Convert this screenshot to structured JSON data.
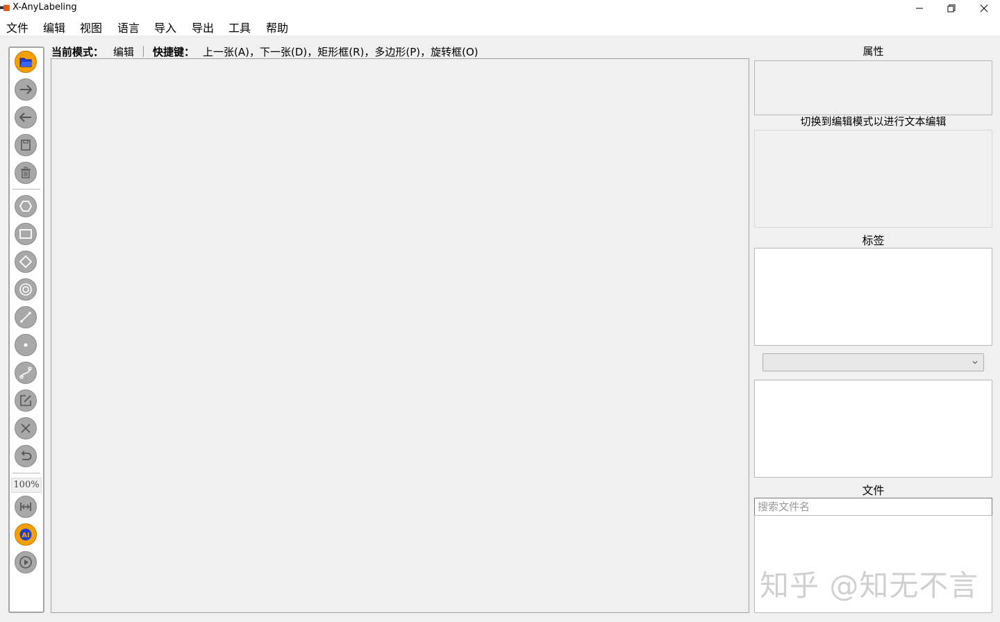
{
  "window": {
    "title": "X-AnyLabeling"
  },
  "menu": [
    "文件",
    "编辑",
    "视图",
    "语言",
    "导入",
    "导出",
    "工具",
    "帮助"
  ],
  "modebar": {
    "mode_label": "当前模式：",
    "mode_value": "编辑",
    "shortcut_label": "快捷键：",
    "shortcut_value": "上一张(A)，下一张(D)，矩形框(R)，多边形(P)，旋转框(O)"
  },
  "toolbar": {
    "zoom": "100%"
  },
  "panels": {
    "attributes_title": "属性",
    "text_edit_hint": "切换到编辑模式以进行文本编辑",
    "labels_title": "标签",
    "files_title": "文件",
    "search_placeholder": "搜索文件名"
  },
  "watermark": "知乎 @知无不言",
  "colors": {
    "accent": "#f5a000",
    "tool_gray": "#a8a8a8"
  },
  "icons": [
    "open-folder-icon",
    "next-arrow-icon",
    "prev-arrow-icon",
    "save-icon",
    "delete-icon",
    "polygon-icon",
    "rectangle-icon",
    "rotation-icon",
    "circle-icon",
    "line-icon",
    "point-icon",
    "linestrip-icon",
    "edit-icon",
    "close-icon",
    "undo-icon",
    "fit-width-icon",
    "ai-icon",
    "play-icon"
  ]
}
